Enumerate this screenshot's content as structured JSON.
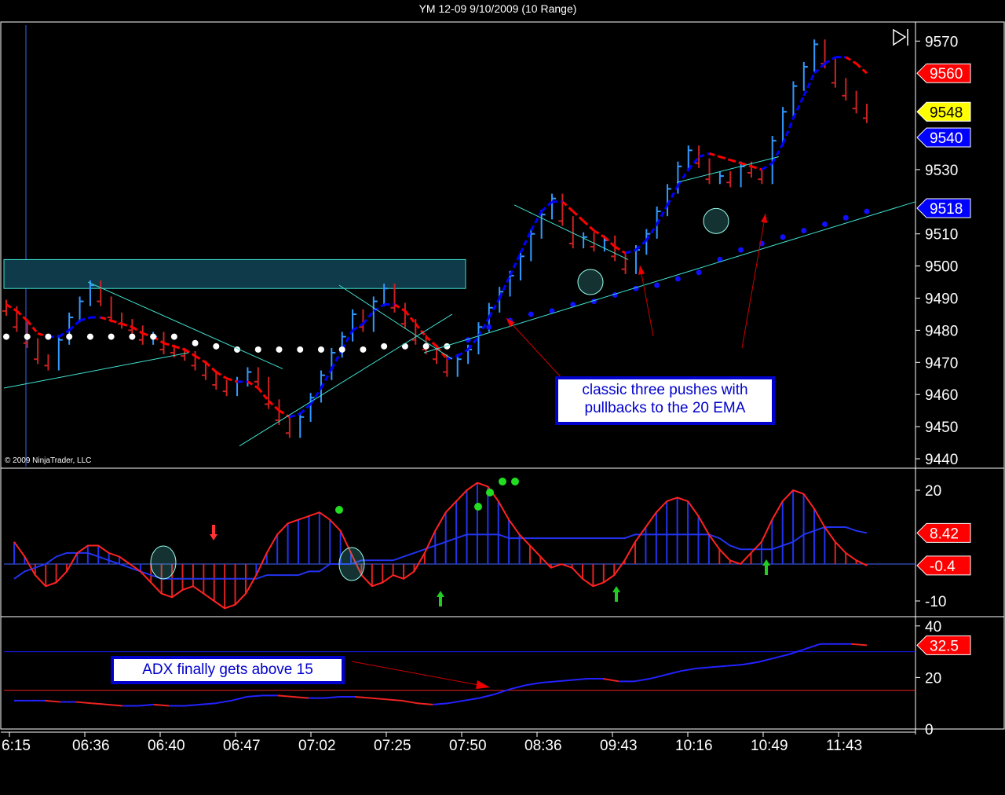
{
  "title": "YM 12-09  9/10/2009 (10 Range)",
  "copyright": "© 2009 NinjaTrader, LLC",
  "colors": {
    "background": "#000000",
    "up_bar": "#3399ff",
    "down_bar": "#cc2222",
    "ema_up": "#0000ff",
    "ema_down": "#ff0000",
    "trendline": "#40e0d0",
    "zone": "#0f3a4a"
  },
  "annotations": {
    "price_note": "classic three pushes with pullbacks to the 20 EMA",
    "adx_note": "ADX finally gets above 15"
  },
  "chart_data": [
    {
      "type": "bar",
      "panel": "price",
      "ylim": [
        9440,
        9574
      ],
      "y_ticks": [
        "9570",
        "9530",
        "9510",
        "9500",
        "9490",
        "9480",
        "9470",
        "9460",
        "9450",
        "9440"
      ],
      "x_tick_labels": [
        "6:15",
        "06:36",
        "06:40",
        "06:47",
        "07:02",
        "07:25",
        "07:50",
        "08:36",
        "09:43",
        "10:16",
        "10:49",
        "11:43"
      ],
      "price_tags": [
        {
          "label": "9560",
          "value": 9560,
          "color": "#ff0000",
          "text_color": "#ffffff"
        },
        {
          "label": "9548",
          "value": 9548,
          "color": "#ffff00",
          "text_color": "#000000"
        },
        {
          "label": "9540",
          "value": 9540,
          "color": "#0000ff",
          "text_color": "#ffffff"
        },
        {
          "label": "9518",
          "value": 9518,
          "color": "#0000ff",
          "text_color": "#ffffff"
        }
      ],
      "series": [
        {
          "name": "",
          "kind": "close",
          "values": [
            9486,
            9481,
            9476,
            9471,
            9469,
            9477,
            9484,
            9489,
            9494,
            9489,
            9484,
            9482,
            9480,
            9477,
            9478,
            9474,
            9473,
            9472,
            9469,
            9466,
            9463,
            9461,
            9464,
            9467,
            9464,
            9457,
            9452,
            9448,
            9453,
            9459,
            9466,
            9473,
            9478,
            9485,
            9481,
            9489,
            9493,
            9487,
            9482,
            9477,
            9474,
            9471,
            9467,
            9471,
            9474,
            9481,
            9487,
            9492,
            9497,
            9503,
            9510,
            9516,
            9521,
            9514,
            9507,
            9509,
            9506,
            9508,
            9503,
            9499,
            9505,
            9510,
            9517,
            9524,
            9531,
            9536,
            9532,
            9527,
            9528,
            9526,
            9531,
            9529,
            9527,
            9539,
            9548,
            9556,
            9562,
            9569,
            9563,
            9557,
            9553,
            9549,
            9546
          ]
        },
        {
          "name": "",
          "kind": "ema",
          "values": [
            9488,
            9486,
            9483,
            9479,
            9478,
            9478,
            9480,
            9483,
            9484,
            9484,
            9483,
            9482,
            9481,
            9479,
            9478,
            9476,
            9475,
            9474,
            9472,
            9470,
            9467,
            9465,
            9464,
            9464,
            9462,
            9458,
            9455,
            9453,
            9454,
            9457,
            9462,
            9468,
            9474,
            9480,
            9482,
            9486,
            9488,
            9488,
            9486,
            9482,
            9478,
            9475,
            9471,
            9472,
            9474,
            9478,
            9484,
            9490,
            9497,
            9504,
            9511,
            9517,
            9520,
            9520,
            9517,
            9514,
            9511,
            9509,
            9506,
            9504,
            9505,
            9508,
            9513,
            9519,
            9525,
            9530,
            9534,
            9535,
            9534,
            9533,
            9532,
            9531,
            9530,
            9532,
            9538,
            9546,
            9553,
            9560,
            9563,
            9565,
            9565,
            9563,
            9560
          ]
        },
        {
          "name": "",
          "kind": "sma_slow",
          "values": [
            9478,
            9478,
            9478,
            9478,
            9478,
            9478,
            9478,
            9478,
            9478,
            9478,
            9478,
            9478,
            9478,
            9478,
            9478,
            9478,
            9478,
            9477,
            9476,
            9475,
            9475,
            9474,
            9474,
            9474,
            9474,
            9474,
            9474,
            9474,
            9474,
            9474,
            9474,
            9474,
            9474,
            9474,
            9474,
            9475,
            9475,
            9475,
            9475,
            9475,
            9475,
            9475,
            9475,
            9475,
            9477,
            9479,
            9481,
            9482,
            9483,
            9484,
            9485,
            9486,
            9486,
            9487,
            9488,
            9488,
            9489,
            9490,
            9491,
            9492,
            9493,
            9494,
            9494,
            9495,
            9496,
            9497,
            9498,
            9500,
            9502,
            9503,
            9505,
            9506,
            9507,
            9508,
            9509,
            9510,
            9511,
            9512,
            9513,
            9514,
            9515,
            9516,
            9517
          ]
        }
      ]
    },
    {
      "type": "line",
      "panel": "oscillator",
      "ylim": [
        -14,
        24
      ],
      "y_ticks": [
        "20",
        "-10"
      ],
      "price_tags": [
        {
          "label": "8.42",
          "value": 8.42,
          "color": "#ff0000",
          "text_color": "#ffffff"
        },
        {
          "label": "-0.4",
          "value": -0.4,
          "color": "#ff0000",
          "text_color": "#ffffff"
        }
      ],
      "series": [
        {
          "name": "",
          "kind": "oscillator",
          "values": [
            6,
            2,
            -3,
            -6,
            -5,
            -2,
            3,
            5,
            5,
            3,
            2,
            0,
            -2,
            -5,
            -8,
            -9,
            -7,
            -6,
            -8,
            -10,
            -12,
            -11,
            -8,
            -3,
            3,
            8,
            11,
            12,
            13,
            14,
            12,
            9,
            3,
            -3,
            -6,
            -5,
            -3,
            -4,
            -2,
            3,
            9,
            14,
            17,
            20,
            22,
            21,
            17,
            12,
            8,
            5,
            2,
            -1,
            0,
            -1,
            -4,
            -6,
            -5,
            -3,
            1,
            6,
            10,
            14,
            17,
            18,
            17,
            13,
            8,
            4,
            1,
            0,
            3,
            6,
            12,
            17,
            20,
            19,
            15,
            10,
            6,
            3,
            1,
            -0.4
          ]
        },
        {
          "name": "",
          "kind": "signal",
          "values": [
            -4,
            -2,
            -1,
            0,
            2,
            3,
            3,
            3,
            2,
            1,
            0,
            -1,
            -2,
            -3,
            -4,
            -4,
            -4,
            -4,
            -4,
            -4,
            -4,
            -4,
            -4,
            -4,
            -3,
            -3,
            -3,
            -3,
            -2,
            -2,
            0,
            0,
            0,
            1,
            1,
            1,
            1,
            2,
            3,
            4,
            5,
            6,
            7,
            8,
            8,
            8,
            8,
            7,
            7,
            7,
            7,
            7,
            7,
            7,
            7,
            7,
            7,
            7,
            7,
            8,
            8,
            8,
            8,
            8,
            8,
            8,
            8,
            7,
            5,
            4,
            4,
            4,
            4,
            5,
            6,
            8,
            9,
            10,
            10,
            10,
            9,
            8.42
          ]
        }
      ]
    },
    {
      "type": "line",
      "panel": "adx",
      "ylim": [
        0,
        40
      ],
      "y_ticks": [
        "40",
        "20",
        "0"
      ],
      "price_tags": [
        {
          "label": "32.5",
          "value": 32.5,
          "color": "#ff0000",
          "text_color": "#ffffff"
        }
      ],
      "series": [
        {
          "name": "",
          "kind": "adx",
          "values": [
            11,
            11,
            11,
            10.5,
            10.5,
            10,
            9.5,
            9,
            9,
            9.5,
            9,
            9,
            9.5,
            10,
            11,
            12.5,
            13,
            13,
            12.5,
            12,
            12,
            12.5,
            12.5,
            12,
            11.5,
            11,
            10,
            9.5,
            10,
            11,
            12,
            13.5,
            15.5,
            17,
            18,
            18.5,
            19,
            19.5,
            19.5,
            18.5,
            18.5,
            19.5,
            21,
            22.5,
            23.5,
            24,
            24.5,
            25,
            26,
            27.5,
            29,
            31,
            33,
            33,
            33,
            32.5
          ]
        }
      ]
    }
  ]
}
